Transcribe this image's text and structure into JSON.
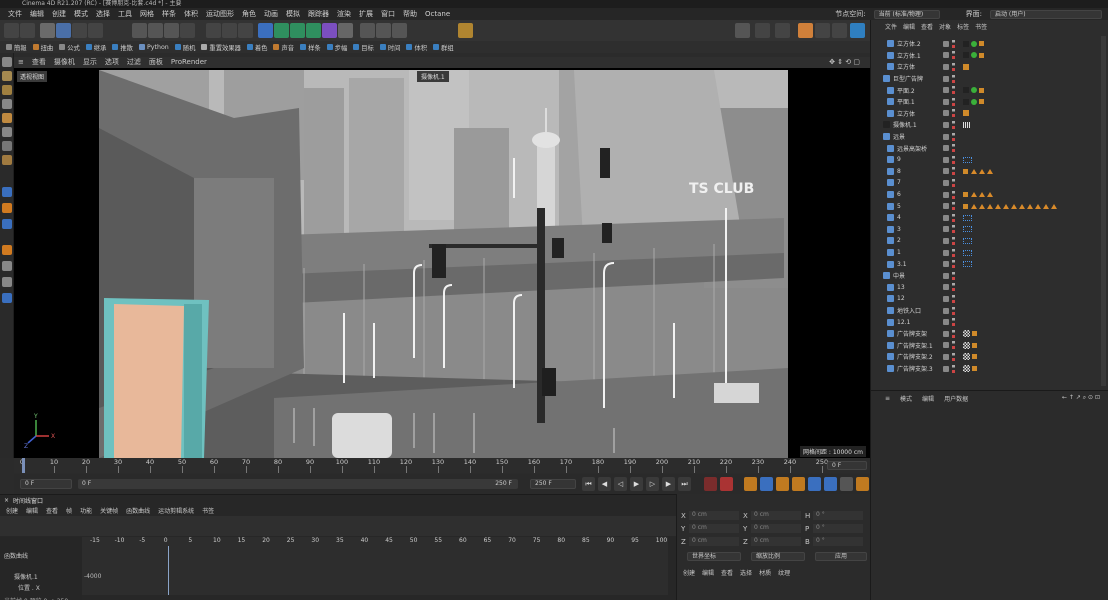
{
  "window": {
    "title": "Cinema 4D R21.207 (RC) - [赛博朋克-比套.c4d *] - 主要"
  },
  "menu": [
    "文件",
    "编辑",
    "创建",
    "模式",
    "选择",
    "工具",
    "网格",
    "样条",
    "体积",
    "运动图形",
    "角色",
    "动画",
    "模拟",
    "跟踪器",
    "渲染",
    "扩展",
    "窗口",
    "帮助",
    "Octane"
  ],
  "menu_right": {
    "space_label": "节点空间:",
    "space_value": "当前 (标准/物理)",
    "ui_label": "界面:",
    "ui_value": "启动 (用户)"
  },
  "toolbar2": [
    "簡報",
    "扭曲",
    "公式",
    "继承",
    "推散",
    "Python",
    "随机",
    "重置效果器",
    "着色",
    "声音",
    "样条",
    "步幅",
    "目标",
    "时间",
    "体积",
    "群组"
  ],
  "viewport": {
    "menu": [
      "查看",
      "摄像机",
      "显示",
      "选项",
      "过滤",
      "面板",
      "ProRender"
    ],
    "view_label": "透视视图",
    "camera_label": "摄像机.1",
    "grid_distance": "网格间距 : 10000 cm",
    "scene_text": "TS CLUB"
  },
  "timeline": {
    "ticks": [
      "0",
      "10",
      "20",
      "30",
      "40",
      "50",
      "60",
      "70",
      "80",
      "90",
      "100",
      "110",
      "120",
      "130",
      "140",
      "150",
      "160",
      "170",
      "180",
      "190",
      "200",
      "210",
      "220",
      "230",
      "240",
      "250"
    ],
    "current_frame": "0 F",
    "start": "0 F",
    "start2": "0 F",
    "end": "250 F",
    "end2": "250 F"
  },
  "tl_panel": {
    "title": "时间线窗口",
    "menu": [
      "创建",
      "编辑",
      "查看",
      "帧",
      "功能",
      "关键帧",
      "函数曲线",
      "运动剪辑系统",
      "书签"
    ],
    "ruler": [
      "-15",
      "-10",
      "-5",
      "0",
      "5",
      "10",
      "15",
      "20",
      "25",
      "30",
      "35",
      "40",
      "45",
      "50",
      "55",
      "60",
      "65",
      "70",
      "75",
      "80",
      "85",
      "90",
      "95",
      "100"
    ],
    "left_label": "函数曲线",
    "tracks": [
      "摄像机.1",
      "位置 . X"
    ],
    "value": "-4000",
    "status": "当前帧 0  预览  0-->250"
  },
  "coords": {
    "rows": [
      [
        "X",
        "0 cm",
        "X",
        "0 cm",
        "H",
        "0 °"
      ],
      [
        "Y",
        "0 cm",
        "Y",
        "0 cm",
        "P",
        "0 °"
      ],
      [
        "Z",
        "0 cm",
        "Z",
        "0 cm",
        "B",
        "0 °"
      ]
    ],
    "mode1": "世界坐标",
    "mode2": "缩放比例",
    "apply": "应用",
    "menu": [
      "创建",
      "编辑",
      "查看",
      "选择",
      "材质",
      "纹理"
    ]
  },
  "objects": {
    "menu": [
      "文件",
      "编辑",
      "查看",
      "对象",
      "标签",
      "书签"
    ],
    "rows": [
      {
        "name": "立方体.2",
        "indent": 1,
        "tags": "cube"
      },
      {
        "name": "立方体.1",
        "indent": 1,
        "tags": "cube"
      },
      {
        "name": "立方体",
        "indent": 1,
        "tags": "x"
      },
      {
        "name": "巨型广告牌",
        "indent": 0,
        "tags": ""
      },
      {
        "name": "平面.2",
        "indent": 1,
        "tags": "cube"
      },
      {
        "name": "平面.1",
        "indent": 1,
        "tags": "cube"
      },
      {
        "name": "立方体",
        "indent": 1,
        "tags": "x"
      },
      {
        "name": "摄像机.1",
        "indent": 0,
        "tags": "cam"
      },
      {
        "name": "远景",
        "indent": 0,
        "tags": ""
      },
      {
        "name": "远景高架桥",
        "indent": 1,
        "tags": ""
      },
      {
        "name": "9",
        "indent": 1,
        "tags": "blue"
      },
      {
        "name": "8",
        "indent": 1,
        "tags": "tri3"
      },
      {
        "name": "7",
        "indent": 1,
        "tags": ""
      },
      {
        "name": "6",
        "indent": 1,
        "tags": "tri4"
      },
      {
        "name": "5",
        "indent": 1,
        "tags": "tri12"
      },
      {
        "name": "4",
        "indent": 1,
        "tags": "blue"
      },
      {
        "name": "3",
        "indent": 1,
        "tags": "blue"
      },
      {
        "name": "2",
        "indent": 1,
        "tags": "blue"
      },
      {
        "name": "1",
        "indent": 1,
        "tags": "blue"
      },
      {
        "name": "3.1",
        "indent": 1,
        "tags": "blue"
      },
      {
        "name": "中景",
        "indent": 0,
        "tags": ""
      },
      {
        "name": "13",
        "indent": 1,
        "tags": ""
      },
      {
        "name": "12",
        "indent": 1,
        "tags": ""
      },
      {
        "name": "地铁入口",
        "indent": 1,
        "tags": ""
      },
      {
        "name": "12.1",
        "indent": 1,
        "tags": ""
      },
      {
        "name": "广告牌支架",
        "indent": 1,
        "tags": "chk"
      },
      {
        "name": "广告牌支架.1",
        "indent": 1,
        "tags": "chk"
      },
      {
        "name": "广告牌支架.2",
        "indent": 1,
        "tags": "chk"
      },
      {
        "name": "广告牌支架.3",
        "indent": 1,
        "tags": "chk"
      }
    ]
  },
  "attr": {
    "menu": [
      "模式",
      "编辑",
      "用户数据"
    ]
  }
}
